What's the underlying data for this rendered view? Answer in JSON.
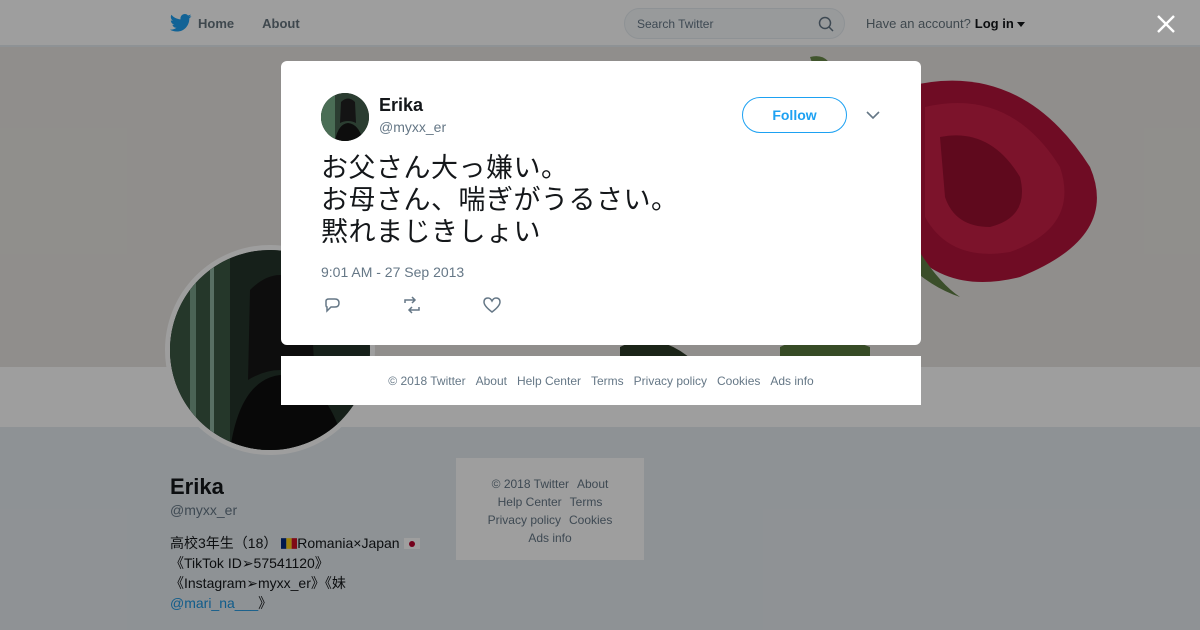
{
  "nav": {
    "home_label": "Home",
    "about_label": "About",
    "search_placeholder": "Search Twitter",
    "account_prompt": "Have an account?",
    "login_label": "Log in"
  },
  "profile": {
    "name": "Erika",
    "handle": "@myxx_er",
    "bio_line1_pre": "高校3年生（18）",
    "bio_line1_post": "Romania×Japan",
    "bio_line2": "《TikTok ID➢57541120》",
    "bio_line3": "《Instagram➢myxx_er》《妹",
    "bio_link": "@mari_na___",
    "bio_line4_post": "》"
  },
  "side_footer": {
    "row1": [
      "© 2018 Twitter",
      "About"
    ],
    "row2": [
      "Help Center",
      "Terms"
    ],
    "row3": [
      "Privacy policy",
      "Cookies"
    ],
    "row4": [
      "Ads info"
    ]
  },
  "tweet": {
    "author_name": "Erika",
    "author_handle": "@myxx_er",
    "follow_label": "Follow",
    "text_lines": [
      "お父さん大っ嫌い。",
      "お母さん、喘ぎがうるさい。",
      "黙れまじきしょい"
    ],
    "timestamp": "9:01 AM - 27 Sep 2013"
  },
  "modal_footer": {
    "copyright": "© 2018 Twitter",
    "about": "About",
    "help": "Help Center",
    "terms": "Terms",
    "privacy": "Privacy policy",
    "cookies": "Cookies",
    "ads": "Ads info"
  },
  "colors": {
    "accent": "#1da1f2",
    "text": "#14171a",
    "muted": "#657786"
  }
}
